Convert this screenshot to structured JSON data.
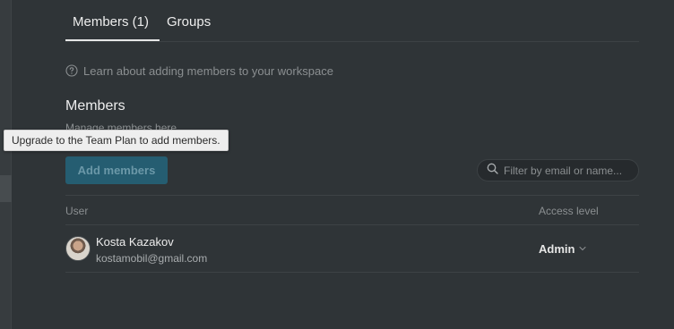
{
  "tabs": [
    {
      "label": "Members (1)",
      "active": true
    },
    {
      "label": "Groups",
      "active": false
    }
  ],
  "learn_link": {
    "icon": "help-circle-icon",
    "text": "Learn about adding members to your workspace"
  },
  "members_section": {
    "title": "Members",
    "subtitle": "Manage members here",
    "add_button_label": "Add members",
    "add_button_disabled": true
  },
  "tooltip": {
    "text": "Upgrade to the Team Plan to add members."
  },
  "filter": {
    "placeholder": "Filter by email or name...",
    "value": "",
    "icon": "search-icon"
  },
  "table": {
    "columns": {
      "user": "User",
      "access": "Access level"
    },
    "rows": [
      {
        "name": "Kosta Kazakov",
        "email": "kostamobil@gmail.com",
        "access": "Admin",
        "access_icon": "chevron-down-icon"
      }
    ]
  },
  "colors": {
    "background": "#2f3437",
    "button_bg": "#255d71",
    "tooltip_bg": "#eeeeee"
  }
}
